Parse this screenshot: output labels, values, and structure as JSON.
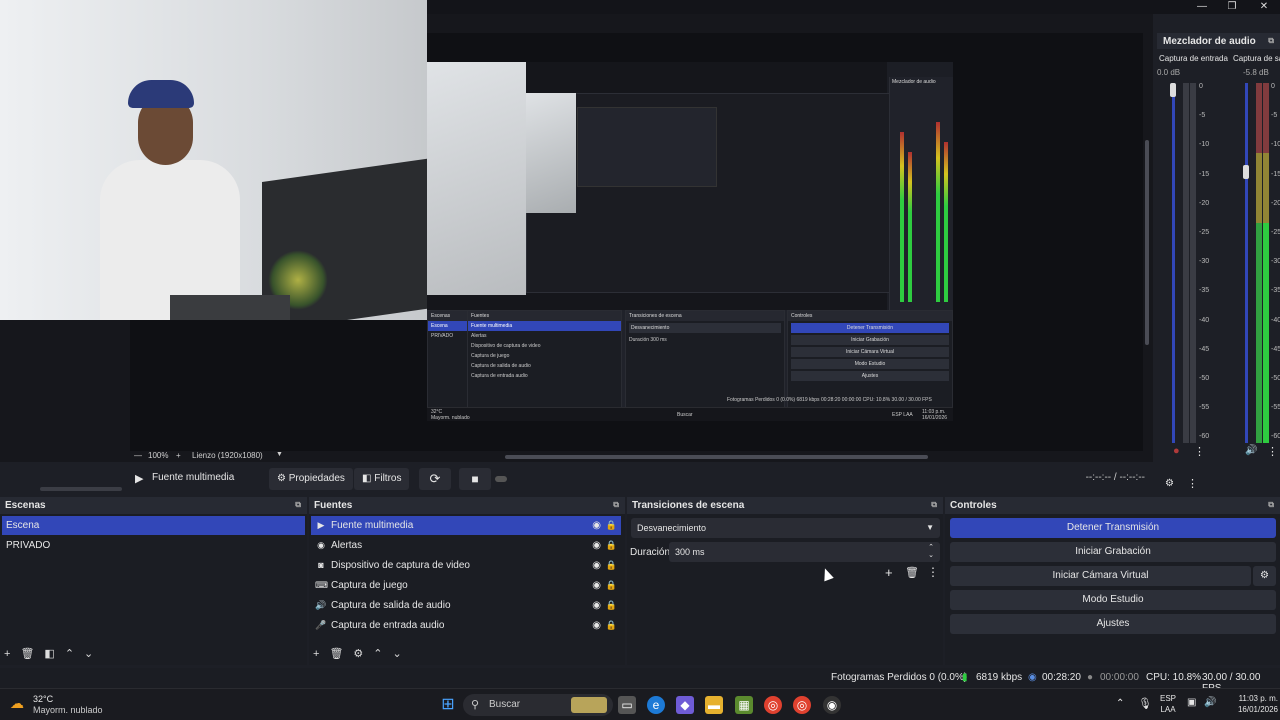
{
  "window": {
    "minimize": "—",
    "maximize": "❐",
    "close": "✕"
  },
  "preview": {
    "zoom_minus": "—",
    "zoom_value": "100%",
    "zoom_plus": "+",
    "canvas_label": "Lienzo (1920x1080)",
    "nested": {
      "mixer_title": "Mezclador de audio",
      "scene_dock": "Escenas",
      "scene_sel": "Escena",
      "scene_2": "PRIVADO",
      "src_dock": "Fuentes",
      "src_items": [
        "Fuente multimedia",
        "Alertas",
        "Dispositivo de captura de video",
        "Captura de juego",
        "Captura de salida de audio",
        "Captura de entrada audio"
      ],
      "trans_dock": "Transiciones de escena",
      "trans_value": "Desvanecimiento",
      "trans_dur_label": "Duración",
      "trans_dur": "300 ms",
      "ctrl_dock": "Controles",
      "ctrl_btns": [
        "Detener Transmisión",
        "Iniciar Grabación",
        "Iniciar Cámara Virtual",
        "Modo Estudio",
        "Ajustes"
      ],
      "props": "Propiedades",
      "filters": "Filtros",
      "status": "Fotogramas Perdidos 0 (0.0%)   6819 kbps   00:28:20   00:00:00   CPU: 10.8%   30.00 / 30.00 FPS",
      "weather_temp": "32°C",
      "weather_desc": "Mayorm. nublado",
      "search": "Buscar",
      "lang": "ESP LAA",
      "time": "11:03 p.m.",
      "date": "16/01/2026"
    }
  },
  "media": {
    "play_icon": "▶",
    "source_name": "Fuente multimedia",
    "properties": "Propiedades",
    "filters": "Filtros",
    "restart_icon": "⟳",
    "stop_icon": "■",
    "time": "--:--:-- / --:--:--"
  },
  "mixer": {
    "title": "Mezclador de audio",
    "ch1_name": "Captura de entrada",
    "ch1_db": "0.0 dB",
    "ch2_name": "Captura de salida",
    "ch2_db": "-5.8 dB",
    "ticks": [
      "0",
      "-5",
      "-10",
      "-15",
      "-20",
      "-25",
      "-30",
      "-35",
      "-40",
      "-45",
      "-50",
      "-55",
      "-60"
    ],
    "ch1_meter_level": 0,
    "ch2_meter_level": 0.85
  },
  "scenes": {
    "title": "Escenas",
    "items": [
      "Escena",
      "PRIVADO"
    ]
  },
  "sources": {
    "title": "Fuentes",
    "items": [
      {
        "icon": "▶",
        "label": "Fuente multimedia"
      },
      {
        "icon": "◉",
        "label": "Alertas"
      },
      {
        "icon": "◙",
        "label": "Dispositivo de captura de video"
      },
      {
        "icon": "⌨",
        "label": "Captura de juego"
      },
      {
        "icon": "🔊",
        "label": "Captura de salida de audio"
      },
      {
        "icon": "🎤",
        "label": "Captura de entrada audio"
      }
    ]
  },
  "transitions": {
    "title": "Transiciones de escena",
    "type": "Desvanecimiento",
    "duration_label": "Duración",
    "duration": "300 ms"
  },
  "controls": {
    "title": "Controles",
    "stop_stream": "Detener Transmisión",
    "start_rec": "Iniciar Grabación",
    "start_vcam": "Iniciar Cámara Virtual",
    "studio": "Modo Estudio",
    "settings": "Ajustes"
  },
  "status": {
    "dropped": "Fotogramas Perdidos 0 (0.0%)",
    "bitrate": "6819 kbps",
    "live_time": "00:28:20",
    "rec_time": "00:00:00",
    "cpu": "CPU: 10.8%",
    "fps": "30.00 / 30.00 FPS"
  },
  "taskbar": {
    "weather_temp": "32°C",
    "weather_desc": "Mayorm. nublado",
    "search": "Buscar",
    "lang1": "ESP",
    "lang2": "LAA",
    "time": "11:03 p. m.",
    "date": "16/01/2026"
  },
  "colors": {
    "accent": "#3247b8",
    "meter_green": "#2ecc40",
    "meter_yellow": "#cbb52c",
    "meter_red": "#b03a3a"
  }
}
